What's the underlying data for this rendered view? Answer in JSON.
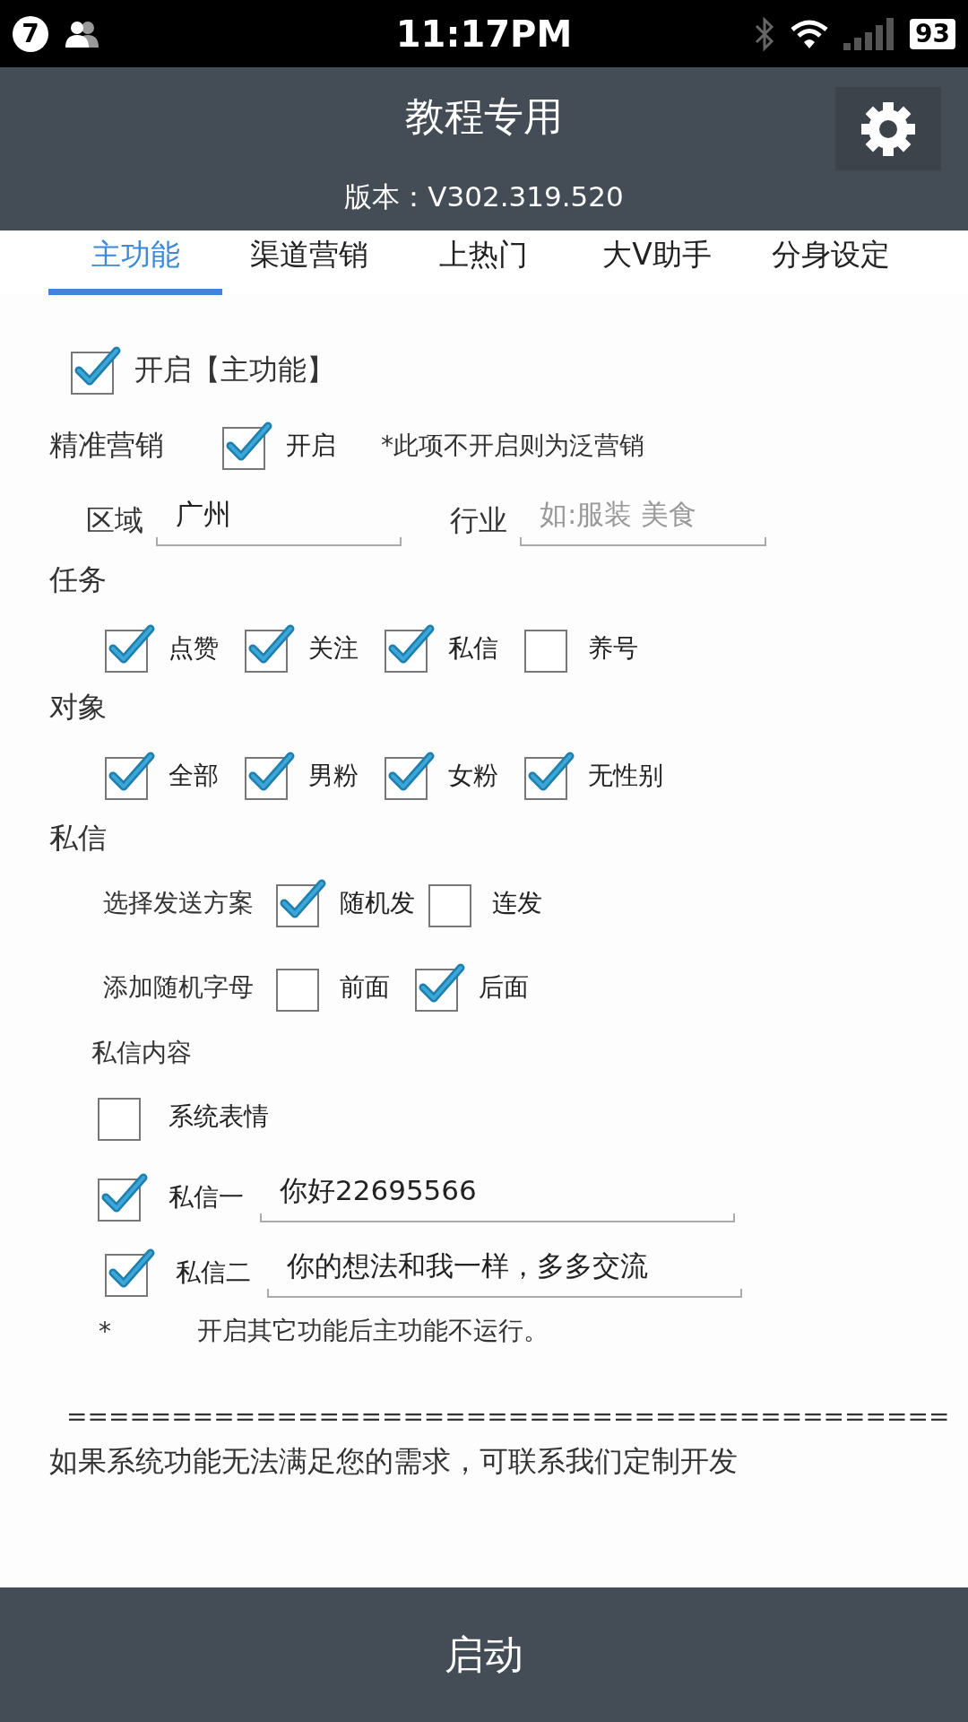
{
  "status_bar": {
    "notification_count": "7",
    "time": "11:17PM",
    "battery": "93"
  },
  "header": {
    "title": "教程专用",
    "version": "版本：V302.319.520"
  },
  "tabs": [
    {
      "label": "主功能",
      "selected": true
    },
    {
      "label": "渠道营销",
      "selected": false
    },
    {
      "label": "上热门",
      "selected": false
    },
    {
      "label": "大V助手",
      "selected": false
    },
    {
      "label": "分身设定",
      "selected": false
    }
  ],
  "main_switch": {
    "label": "开启【主功能】",
    "checked": true
  },
  "precise_marketing": {
    "label": "精准营销",
    "option": {
      "label": "开启",
      "checked": true
    },
    "note": "*此项不开启则为泛营销"
  },
  "region": {
    "label": "区域",
    "value": "广州"
  },
  "industry": {
    "label": "行业",
    "placeholder": "如:服装 美食"
  },
  "tasks": {
    "label": "任务",
    "options": [
      {
        "label": "点赞",
        "checked": true
      },
      {
        "label": "关注",
        "checked": true
      },
      {
        "label": "私信",
        "checked": true
      },
      {
        "label": "养号",
        "checked": false
      }
    ]
  },
  "targets": {
    "label": "对象",
    "options": [
      {
        "label": "全部",
        "checked": true
      },
      {
        "label": "男粉",
        "checked": true
      },
      {
        "label": "女粉",
        "checked": true
      },
      {
        "label": "无性别",
        "checked": true
      }
    ]
  },
  "messages": {
    "label": "私信",
    "send_mode": {
      "label": "选择发送方案",
      "options": [
        {
          "label": "随机发",
          "checked": true
        },
        {
          "label": "连发",
          "checked": false
        }
      ]
    },
    "random_letters": {
      "label": "添加随机字母",
      "options": [
        {
          "label": "前面",
          "checked": false
        },
        {
          "label": "后面",
          "checked": true
        }
      ]
    },
    "content_label": "私信内容",
    "emoji": {
      "label": "系统表情",
      "checked": false
    },
    "entries": [
      {
        "label": "私信一",
        "checked": true,
        "value": "你好22695566"
      },
      {
        "label": "私信二",
        "checked": true,
        "value": "你的想法和我一样，多多交流"
      }
    ],
    "note_mark": "*",
    "note": "开启其它功能后主功能不运行。"
  },
  "separator": "==========================================",
  "contact": "如果系统功能无法满足您的需求，可联系我们定制开发",
  "start_button": "启动"
}
